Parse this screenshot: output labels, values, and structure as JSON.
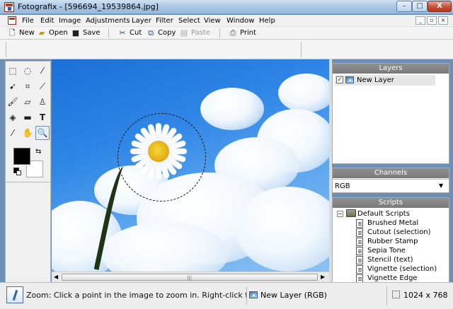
{
  "window": {
    "title": "Fotografix - [596694_19539864.jpg]",
    "controls": {
      "minimize": "–",
      "maximize": "□",
      "close": "X"
    }
  },
  "menu": {
    "items": [
      "File",
      "Edit",
      "Image",
      "Adjustments",
      "Layer",
      "Filter",
      "Select",
      "View",
      "Window",
      "Help"
    ],
    "mdi_controls": {
      "minimize": "_",
      "restore": "▫",
      "close": "×"
    }
  },
  "toolbar": {
    "new": "New",
    "open": "Open",
    "save": "Save",
    "cut": "Cut",
    "copy": "Copy",
    "paste": "Paste",
    "print": "Print"
  },
  "panels": {
    "layers": {
      "title": "Layers",
      "items": [
        {
          "name": "New Layer",
          "visible": true,
          "check_mark": "✓"
        }
      ]
    },
    "channels": {
      "title": "Channels",
      "selected": "RGB",
      "arrow": "▼"
    },
    "scripts": {
      "title": "Scripts",
      "toggle": "−",
      "folder": "Default Scripts",
      "items": [
        "Brushed Metal",
        "Cutout (selection)",
        "Rubber Stamp",
        "Sepia Tone",
        "Stencil (text)",
        "Vignette (selection)",
        "Vignette Edge"
      ]
    }
  },
  "tools": {
    "active": "zoom",
    "swap_glyph": "⇆",
    "foreground_color": "#000000",
    "background_color": "#ffffff"
  },
  "scrollbar": {
    "left_arrow": "◀",
    "right_arrow": "▶",
    "grip": "|||"
  },
  "status": {
    "message": "Zoom: Click a point in the image to zoom in. Right-click to zoom out.",
    "layer": "New Layer (RGB)",
    "size": "1024 x 768"
  },
  "colors": {
    "title_bar": "#a9c6e4",
    "panel_header": "#858585",
    "sky": "#2f86e6"
  }
}
